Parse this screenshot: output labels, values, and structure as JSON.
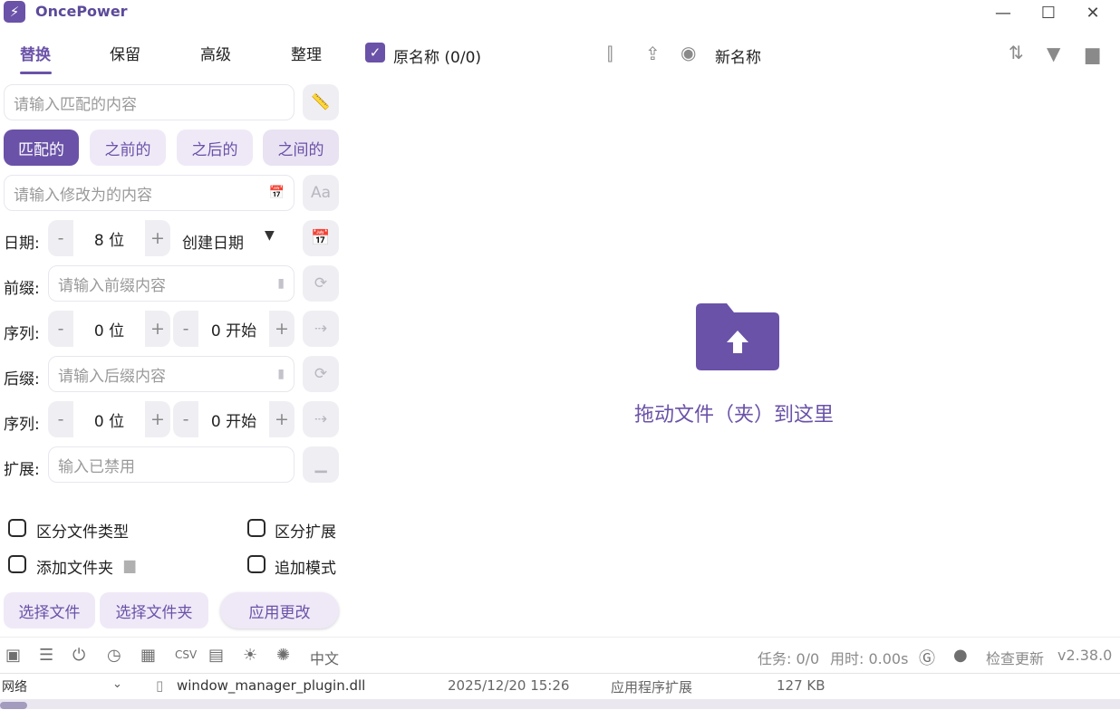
{
  "app": {
    "title": "OncePower",
    "icon": "lightning-icon"
  },
  "window_controls": {
    "minimize": "—",
    "maximize": "☐",
    "close": "✕"
  },
  "tabs": [
    {
      "label": "替换",
      "active": true
    },
    {
      "label": "保留",
      "active": false
    },
    {
      "label": "高级",
      "active": false
    },
    {
      "label": "整理",
      "active": false
    }
  ],
  "replace": {
    "match_placeholder": "请输入匹配的内容",
    "modes": [
      "匹配的",
      "之前的",
      "之后的",
      "之间的"
    ],
    "modify_placeholder": "请输入修改为的内容"
  },
  "date": {
    "label": "日期:",
    "digits": "8 位",
    "type": "创建日期"
  },
  "prefix": {
    "label": "前缀:",
    "placeholder": "请输入前缀内容",
    "seq_label": "序列:",
    "seq_digits": "0 位",
    "seq_start": "0 开始"
  },
  "suffix": {
    "label": "后缀:",
    "placeholder": "请输入后缀内容",
    "seq_label": "序列:",
    "seq_digits": "0 位",
    "seq_start": "0 开始"
  },
  "extension": {
    "label": "扩展:",
    "placeholder": "输入已禁用"
  },
  "options": {
    "distinguish_type": "区分文件类型",
    "distinguish_ext": "区分扩展",
    "add_folder": "添加文件夹",
    "append_mode": "追加模式"
  },
  "actions": {
    "select_files": "选择文件",
    "select_folder": "选择文件夹",
    "apply": "应用更改"
  },
  "list_header": {
    "original_label": "原名称 (0/0)",
    "original_checked": true,
    "new_label": "新名称"
  },
  "drop_zone": {
    "text": "拖动文件（夹）到这里"
  },
  "status_bar": {
    "language": "中文",
    "tasks": "任务: 0/0",
    "time": "用时: 0.00s",
    "check_update": "检查更新",
    "version": "v2.38.0"
  },
  "background_window": {
    "sidebar_item": "网络",
    "file_name": "window_manager_plugin.dll",
    "modified": "2025/12/20 15:26",
    "file_type": "应用程序扩展",
    "size": "127 KB"
  },
  "colors": {
    "accent": "#6a52a8",
    "accent_light": "#efe9f7"
  }
}
